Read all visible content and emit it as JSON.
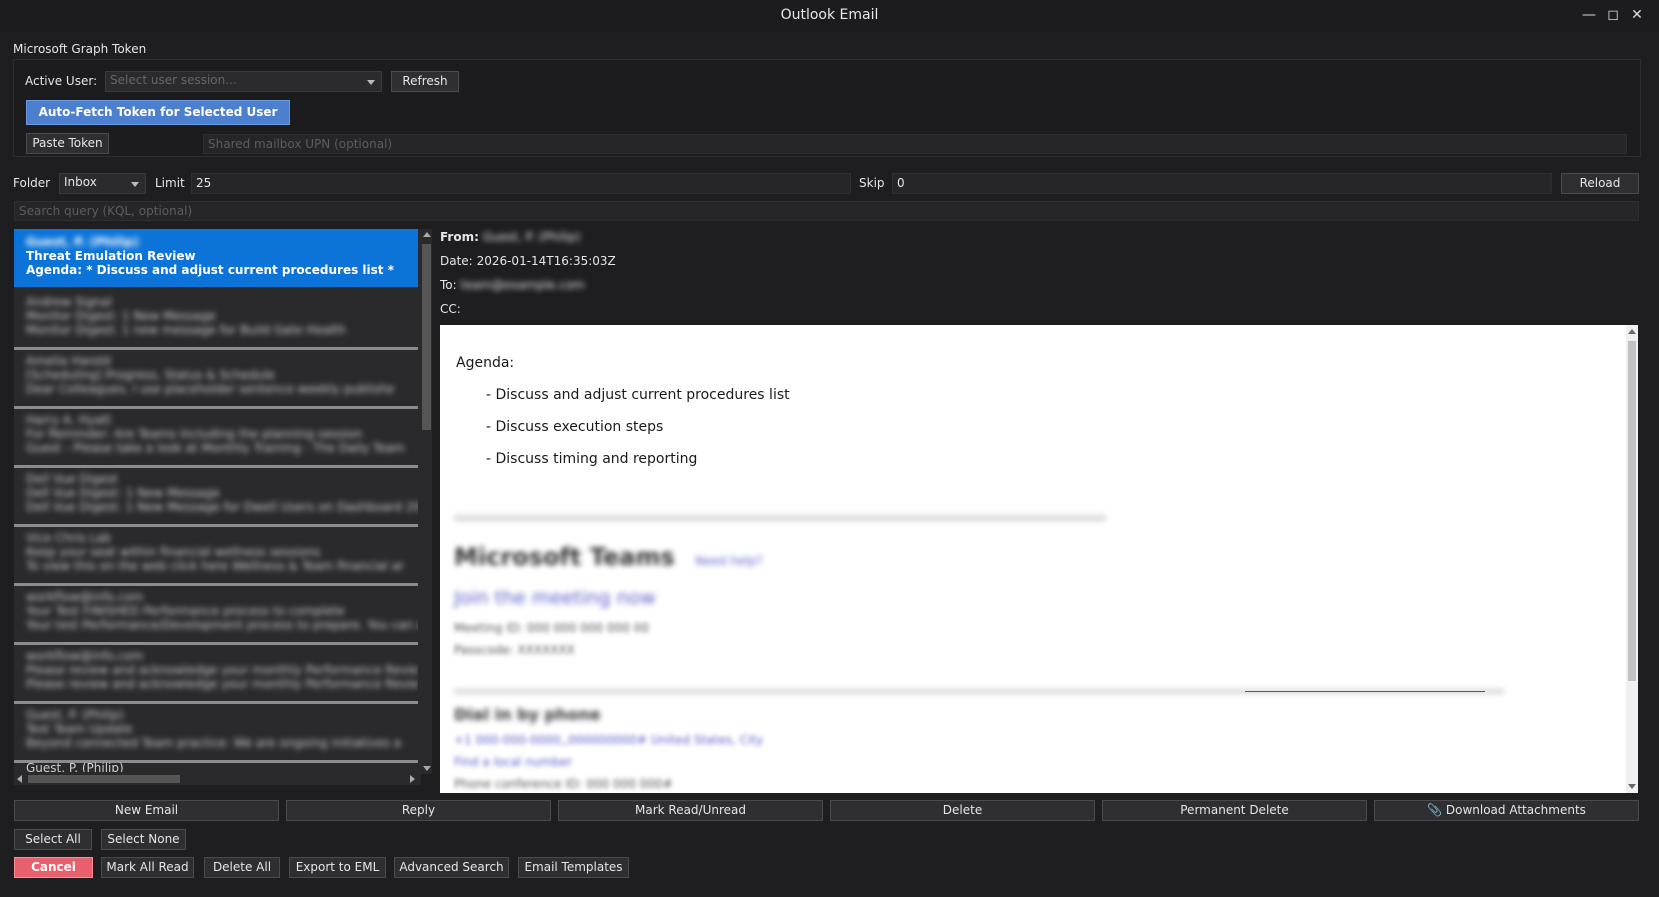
{
  "window": {
    "title": "Outlook Email"
  },
  "token_group": {
    "title": "Microsoft Graph Token",
    "active_user_label": "Active User:",
    "active_user_placeholder": "Select user session...",
    "refresh_label": "Refresh",
    "autofetch_label": "Auto-Fetch Token for Selected User",
    "paste_label": "Paste Token",
    "shared_mailbox_placeholder": "Shared mailbox UPN (optional)"
  },
  "filters": {
    "folder_label": "Folder",
    "folder_value": "Inbox",
    "limit_label": "Limit",
    "limit_value": "25",
    "skip_label": "Skip",
    "skip_value": "0",
    "reload_label": "Reload",
    "search_placeholder": "Search query (KQL, optional)"
  },
  "email_list": {
    "selected": {
      "sender": "Guest, P. (Philip)",
      "subject": "Threat Emulation Review",
      "preview": "Agenda:    * Discuss and adjust current procedures list   *"
    },
    "items": [
      {
        "l1": "Andrew Signal",
        "l2": "Monitor Digest: 1 New Message",
        "l3": "Monitor Digest: 1 new message for Build Gate Health"
      },
      {
        "l1": "Amelia Harold",
        "l2": "[Scheduling] Progress, Status & Schedule",
        "l3": "Dear Colleagues, I use placeholder sentence weekly publishe"
      },
      {
        "l1": "Harry A. Hyatt",
        "l2": "For Reminder: Are Teams Including the planning session",
        "l3": "Guest - Please take a look at Monthly Training - The Daily Team"
      },
      {
        "l1": "Dell Vue Digest",
        "l2": "Dell Vue Digest: 1 New Message",
        "l3": "Dell Vue Digest: 1 New Message for Dwell Users on Dashboard 20"
      },
      {
        "l1": "Vice Chris Lab",
        "l2": "Keep your seat within financial wellness sessions",
        "l3": "To view this on the web click here Wellness & Team financial ar"
      },
      {
        "l1": "workflow@info.com",
        "l2": "Your Test FINISHED Performance process to complete",
        "l3": "Your test Performance/Development process to prepare. You can a"
      },
      {
        "l1": "workflow@info.com",
        "l2": "Please review and acknowledge your monthly Performance Revie",
        "l3": "Please review and acknowledge your monthly Performance Revie"
      },
      {
        "l1": "Guest, P. (Philip)",
        "l2": "Test Team Update",
        "l3": "Beyond connected Team practice: We are ongoing initiatives a"
      }
    ],
    "partial_item": "Guest, P. (Philip)"
  },
  "detail": {
    "from_label": "From:",
    "from_value": "Guest, P. (Philip)",
    "date_label": "Date:",
    "date_value": "2026-01-14T16:35:03Z",
    "to_label": "To:",
    "to_value": "team@example.com",
    "cc_label": "CC:",
    "body": {
      "agenda": "Agenda:",
      "items": [
        "- Discuss and adjust current procedures list",
        "- Discuss execution steps",
        "- Discuss timing and reporting"
      ],
      "teams_title": "Microsoft Teams",
      "teams_help": "Need help?",
      "teams_join": "Join the meeting now",
      "meeting_id": "Meeting ID: 000 000 000 000 00",
      "passcode": "Passcode: XXXXXXX",
      "dial_in": "Dial in by phone",
      "phone": "+1 000-000-0000,,000000000# United States, City",
      "find_number": "Find a local number",
      "phone_conf": "Phone conference ID: 000 000 000#"
    }
  },
  "actions": {
    "new_email": "New Email",
    "reply": "Reply",
    "mark_read": "Mark Read/Unread",
    "delete": "Delete",
    "permanent_delete": "Permanent Delete",
    "download_attachments": "Download Attachments",
    "select_all": "Select All",
    "select_none": "Select None",
    "cancel": "Cancel",
    "mark_all_read": "Mark All Read",
    "delete_all": "Delete All",
    "export_eml": "Export to EML",
    "advanced_search": "Advanced Search",
    "email_templates": "Email Templates"
  },
  "icons": {
    "download": "paperclip-icon",
    "minimize": "minimize-icon",
    "maximize": "maximize-icon",
    "close": "close-icon"
  }
}
